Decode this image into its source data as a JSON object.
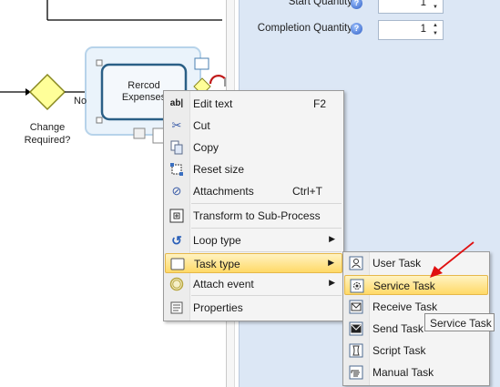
{
  "diagram": {
    "task_label": "Rercod\nExpenses",
    "gateway_label": "Change\nRequired?",
    "flow_label": "No"
  },
  "properties": {
    "fields": [
      {
        "label": "Start Quantity",
        "value": "1"
      },
      {
        "label": "Completion Quantity",
        "value": "1"
      }
    ]
  },
  "context_menu": {
    "items": [
      {
        "label": "Edit text",
        "shortcut": "F2",
        "icon": "edit-text-icon"
      },
      {
        "label": "Cut",
        "icon": "scissors-icon"
      },
      {
        "label": "Copy",
        "icon": "copy-icon"
      },
      {
        "label": "Reset size",
        "icon": "reset-size-icon"
      },
      {
        "label": "Attachments",
        "shortcut": "Ctrl+T",
        "icon": "paperclip-icon"
      },
      {
        "label": "Transform to Sub-Process",
        "icon": "subprocess-icon"
      },
      {
        "label": "Loop type",
        "icon": "loop-icon",
        "submenu": true
      },
      {
        "label": "Task type",
        "icon": "task-icon",
        "submenu": true,
        "highlighted": true
      },
      {
        "label": "Attach event",
        "icon": "event-circle-icon",
        "submenu": true
      },
      {
        "label": "Properties",
        "icon": "properties-icon"
      }
    ]
  },
  "task_type_submenu": {
    "items": [
      {
        "label": "User Task",
        "icon": "user-task-icon"
      },
      {
        "label": "Service Task",
        "icon": "service-task-icon",
        "highlighted": true
      },
      {
        "label": "Receive Task",
        "icon": "receive-task-icon"
      },
      {
        "label": "Send Task",
        "icon": "send-task-icon"
      },
      {
        "label": "Script Task",
        "icon": "script-task-icon"
      },
      {
        "label": "Manual Task",
        "icon": "manual-task-icon"
      }
    ]
  },
  "tooltip": {
    "text": "Service Task"
  },
  "colors": {
    "highlight": "#ffd967",
    "gateway": "#ffff99",
    "annotation_arrow": "#e01010",
    "panel": "#dce7f5"
  }
}
